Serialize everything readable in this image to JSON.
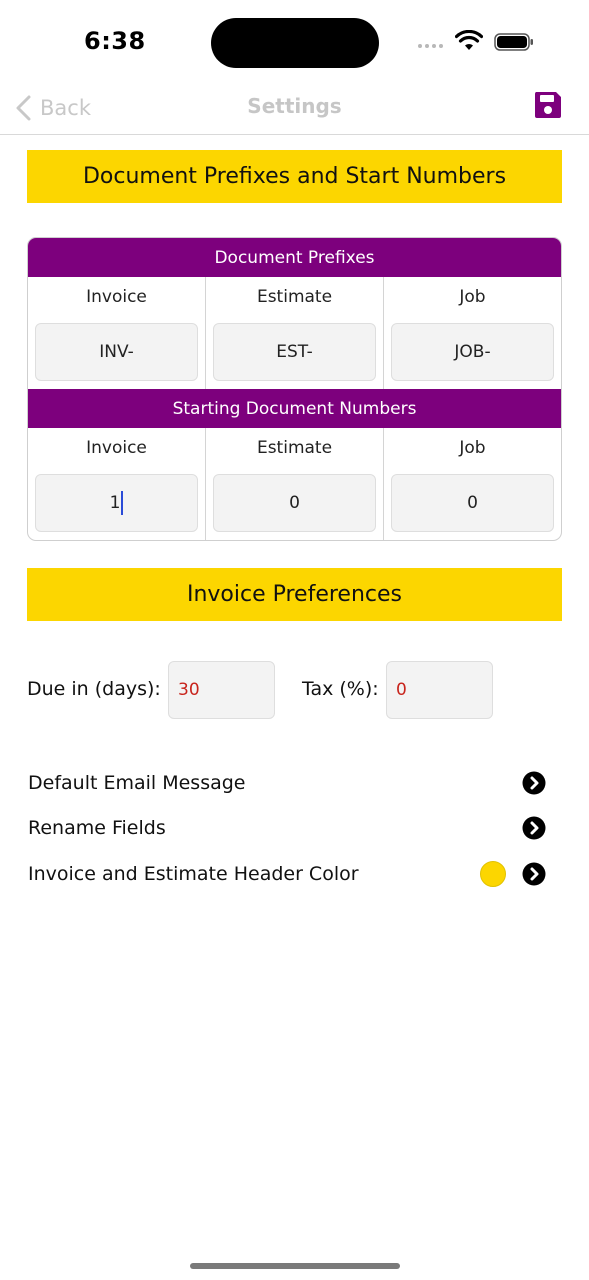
{
  "status_bar": {
    "time": "6:38"
  },
  "nav": {
    "back_label": "Back",
    "title": "Settings",
    "save_icon": "floppy-disk-icon",
    "accent_color": "#7d007d"
  },
  "prefixes_section": {
    "header": "Document Prefixes and Start Numbers",
    "prefix_band": "Document Prefixes",
    "prefix_columns": [
      {
        "label": "Invoice",
        "value": "INV-"
      },
      {
        "label": "Estimate",
        "value": "EST-"
      },
      {
        "label": "Job",
        "value": "JOB-"
      }
    ],
    "numbers_band": "Starting Document Numbers",
    "number_columns": [
      {
        "label": "Invoice",
        "value": "1"
      },
      {
        "label": "Estimate",
        "value": "0"
      },
      {
        "label": "Job",
        "value": "0"
      }
    ]
  },
  "invoice_prefs": {
    "header": "Invoice Preferences",
    "due_label": "Due in (days):",
    "due_value": "30",
    "tax_label": "Tax (%):",
    "tax_value": "0"
  },
  "menu": [
    {
      "label": "Default Email Message",
      "icon": "chevron-right-circle-icon"
    },
    {
      "label": "Rename Fields",
      "icon": "chevron-right-circle-icon"
    },
    {
      "label": "Invoice and Estimate Header Color",
      "icon": "chevron-right-circle-icon",
      "swatch_color": "#fcd600"
    }
  ],
  "colors": {
    "header_yellow": "#fcd600",
    "band_purple": "#7d007d",
    "input_value_red": "#c8241c"
  }
}
